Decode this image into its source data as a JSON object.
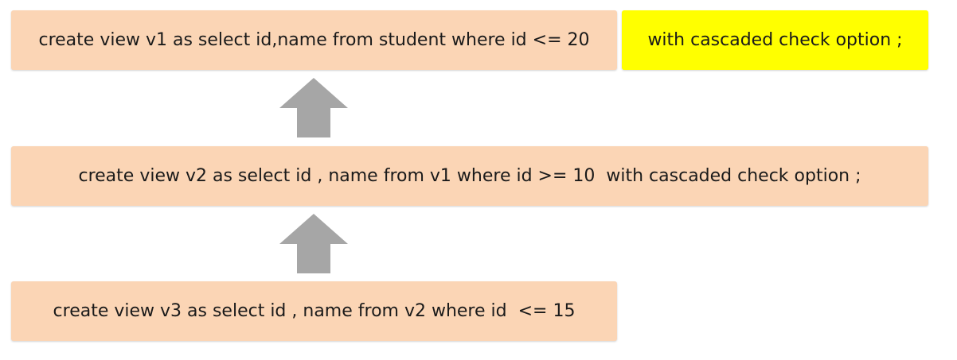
{
  "colors": {
    "box_fill": "#fbd5b5",
    "highlight_fill": "#ffff00",
    "arrow_fill": "#a6a6a6",
    "text": "#1a1a1a"
  },
  "boxes": {
    "v1": {
      "text": "create view v1 as select id,name from student where id <= 20"
    },
    "v1_option": {
      "text": "with cascaded check option ;"
    },
    "v2": {
      "text": "create view v2 as select id , name from v1 where id >= 10  with cascaded check option ;"
    },
    "v3": {
      "text": "create view v3 as select id , name from v2 where id  <= 15"
    }
  },
  "arrows": [
    {
      "icon": "up-arrow-icon",
      "from": "v2",
      "to": "v1"
    },
    {
      "icon": "up-arrow-icon",
      "from": "v3",
      "to": "v2"
    }
  ]
}
